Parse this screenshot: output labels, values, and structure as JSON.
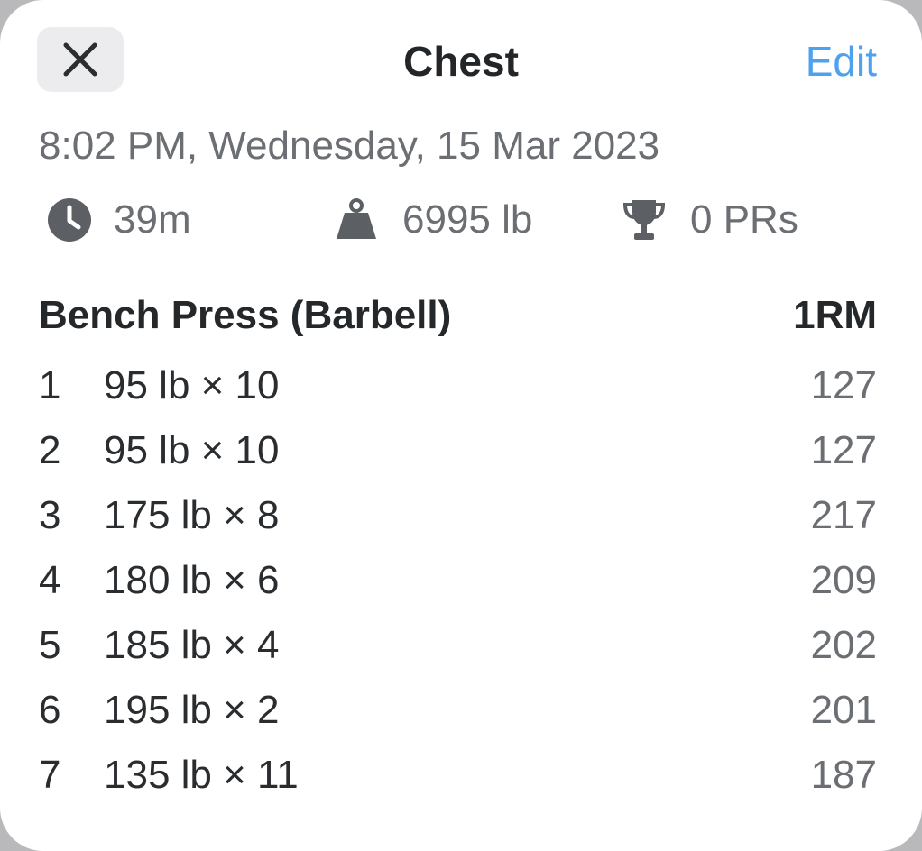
{
  "header": {
    "close_icon": "close-x-icon",
    "title": "Chest",
    "edit_label": "Edit"
  },
  "workout": {
    "datetime": "8:02 PM, Wednesday, 15 Mar 2023"
  },
  "stats": {
    "duration": {
      "icon": "clock-icon",
      "value": "39m"
    },
    "volume": {
      "icon": "weight-icon",
      "value": "6995 lb"
    },
    "prs": {
      "icon": "trophy-icon",
      "value": "0 PRs"
    }
  },
  "exercise": {
    "name": "Bench Press (Barbell)",
    "column_label": "1RM",
    "sets": [
      {
        "num": "1",
        "detail": "95 lb × 10",
        "one_rm": "127"
      },
      {
        "num": "2",
        "detail": "95 lb × 10",
        "one_rm": "127"
      },
      {
        "num": "3",
        "detail": "175 lb × 8",
        "one_rm": "217"
      },
      {
        "num": "4",
        "detail": "180 lb × 6",
        "one_rm": "209"
      },
      {
        "num": "5",
        "detail": "185 lb × 4",
        "one_rm": "202"
      },
      {
        "num": "6",
        "detail": "195 lb × 2",
        "one_rm": "201"
      },
      {
        "num": "7",
        "detail": "135 lb × 11",
        "one_rm": "187"
      }
    ]
  },
  "colors": {
    "accent": "#4da1ef",
    "secondary_text": "#6b6e72",
    "icon_gray": "#5c6064",
    "close_bg": "#ececee"
  }
}
